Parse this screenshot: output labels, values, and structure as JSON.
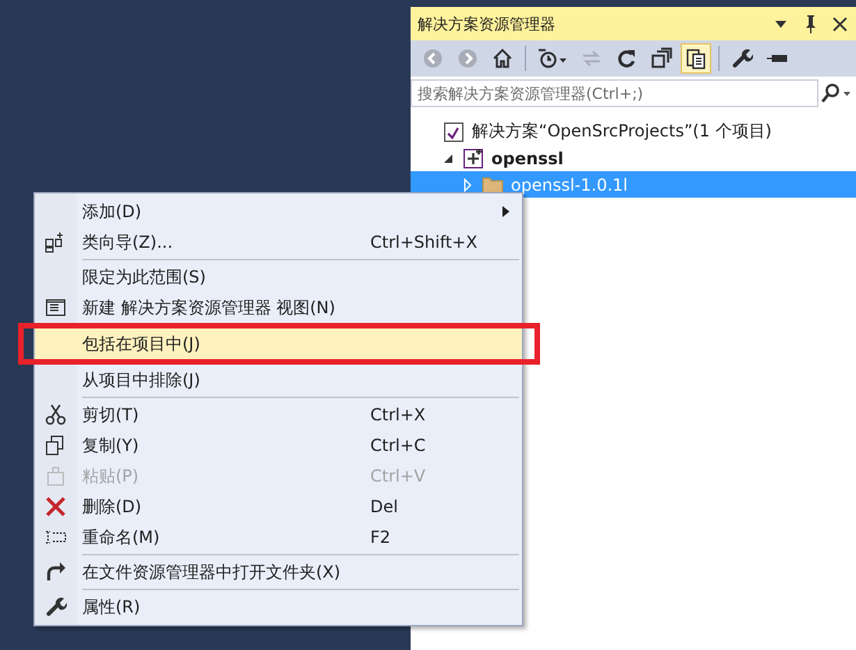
{
  "panel": {
    "title": "解决方案资源管理器",
    "toolbar": [
      {
        "kind": "back",
        "disabled": true,
        "selected": false
      },
      {
        "kind": "forward",
        "disabled": true,
        "selected": false
      },
      {
        "kind": "home",
        "disabled": false,
        "selected": false
      },
      {
        "kind": "separator"
      },
      {
        "kind": "history",
        "disabled": false,
        "selected": false
      },
      {
        "kind": "sync",
        "disabled": true,
        "selected": false
      },
      {
        "kind": "refresh",
        "disabled": false,
        "selected": false
      },
      {
        "kind": "collapse",
        "disabled": false,
        "selected": false
      },
      {
        "kind": "showall",
        "disabled": false,
        "selected": true
      },
      {
        "kind": "separator"
      },
      {
        "kind": "properties",
        "disabled": false,
        "selected": false
      },
      {
        "kind": "preview",
        "disabled": false,
        "selected": false
      }
    ],
    "search": {
      "placeholder": "搜索解决方案资源管理器(Ctrl+;)"
    },
    "tree": [
      {
        "label": "解决方案“OpenSrcProjects”(1 个项目)",
        "kind": "solution",
        "selected": false,
        "children": [
          {
            "label": "openssl",
            "kind": "project",
            "expanded": true,
            "selected": false,
            "children": [
              {
                "label": "openssl-1.0.1l",
                "kind": "folder",
                "expanded": false,
                "selected": true
              }
            ]
          }
        ]
      }
    ]
  },
  "context_menu": {
    "items": [
      {
        "kind": "item",
        "label": "添加(D)",
        "submenu": true,
        "disabled": false,
        "selected": false
      },
      {
        "kind": "item",
        "label": "类向导(Z)...",
        "shortcut": "Ctrl+Shift+X",
        "disabled": false,
        "selected": false
      },
      {
        "kind": "separator"
      },
      {
        "kind": "item",
        "label": "限定为此范围(S)",
        "disabled": false,
        "selected": false
      },
      {
        "kind": "item",
        "label": "新建 解决方案资源管理器 视图(N)",
        "disabled": false,
        "selected": false
      },
      {
        "kind": "item",
        "label": "包括在项目中(J)",
        "disabled": false,
        "selected": true
      },
      {
        "kind": "item",
        "label": "从项目中排除(J)",
        "disabled": false,
        "selected": false
      },
      {
        "kind": "separator"
      },
      {
        "kind": "item",
        "label": "剪切(T)",
        "shortcut": "Ctrl+X",
        "disabled": false,
        "selected": false
      },
      {
        "kind": "item",
        "label": "复制(Y)",
        "shortcut": "Ctrl+C",
        "disabled": false,
        "selected": false
      },
      {
        "kind": "item",
        "label": "粘贴(P)",
        "shortcut": "Ctrl+V",
        "disabled": true,
        "selected": false
      },
      {
        "kind": "item",
        "label": "删除(D)",
        "shortcut": "Del",
        "disabled": false,
        "selected": false
      },
      {
        "kind": "item",
        "label": "重命名(M)",
        "shortcut": "F2",
        "disabled": false,
        "selected": false
      },
      {
        "kind": "separator"
      },
      {
        "kind": "item",
        "label": "在文件资源管理器中打开文件夹(X)",
        "disabled": false,
        "selected": false
      },
      {
        "kind": "separator"
      },
      {
        "kind": "item",
        "label": "属性(R)",
        "disabled": false,
        "selected": false
      }
    ]
  }
}
